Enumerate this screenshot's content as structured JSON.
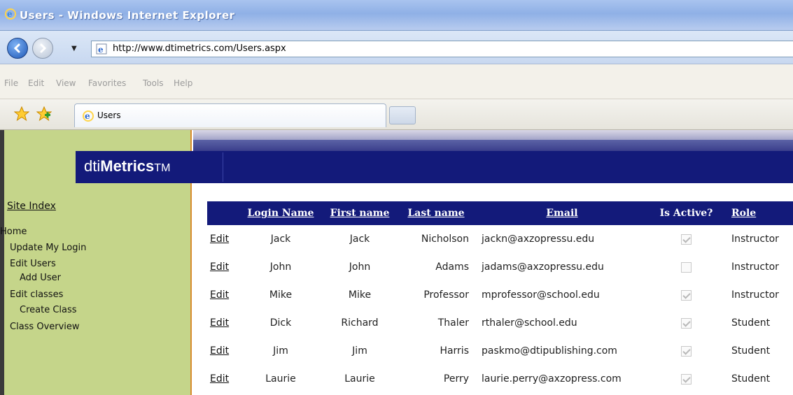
{
  "window": {
    "title": "Users - Windows Internet Explorer"
  },
  "address_bar": {
    "url": "http://www.dtimetrics.com/Users.aspx"
  },
  "menu": {
    "items": [
      "File",
      "Edit",
      "View",
      "Favorites",
      "Tools",
      "Help"
    ]
  },
  "tabs": {
    "active_label": "Users"
  },
  "site": {
    "logo_prefix": "dti",
    "logo_bold": "Metrics",
    "logo_tm": "TM"
  },
  "sidebar": {
    "site_index": "Site Index",
    "links": [
      "Home",
      "Update My Login",
      "Edit Users",
      "Add User",
      "Edit classes",
      "Create Class",
      "Class Overview"
    ]
  },
  "table": {
    "headers": {
      "login_name": "Login Name",
      "first_name": "First name",
      "last_name": "Last name",
      "email": "Email",
      "is_active": "Is Active?",
      "role": "Role"
    },
    "edit_label": "Edit",
    "rows": [
      {
        "login": "Jack",
        "first": "Jack",
        "last": "Nicholson",
        "email": "jackn@axzopressu.edu",
        "active": true,
        "role": "Instructor"
      },
      {
        "login": "John",
        "first": "John",
        "last": "Adams",
        "email": "jadams@axzopressu.edu",
        "active": false,
        "role": "Instructor"
      },
      {
        "login": "Mike",
        "first": "Mike",
        "last": "Professor",
        "email": "mprofessor@school.edu",
        "active": true,
        "role": "Instructor"
      },
      {
        "login": "Dick",
        "first": "Richard",
        "last": "Thaler",
        "email": "rthaler@school.edu",
        "active": true,
        "role": "Student"
      },
      {
        "login": "Jim",
        "first": "Jim",
        "last": "Harris",
        "email": "paskmo@dtipublishing.com",
        "active": true,
        "role": "Student"
      },
      {
        "login": "Laurie",
        "first": "Laurie",
        "last": "Perry",
        "email": "laurie.perry@axzopress.com",
        "active": true,
        "role": "Student"
      }
    ]
  },
  "colors": {
    "header_blue": "#131a7a",
    "sidebar_green": "#c5d58a",
    "sidebar_border": "#d98c2f"
  }
}
